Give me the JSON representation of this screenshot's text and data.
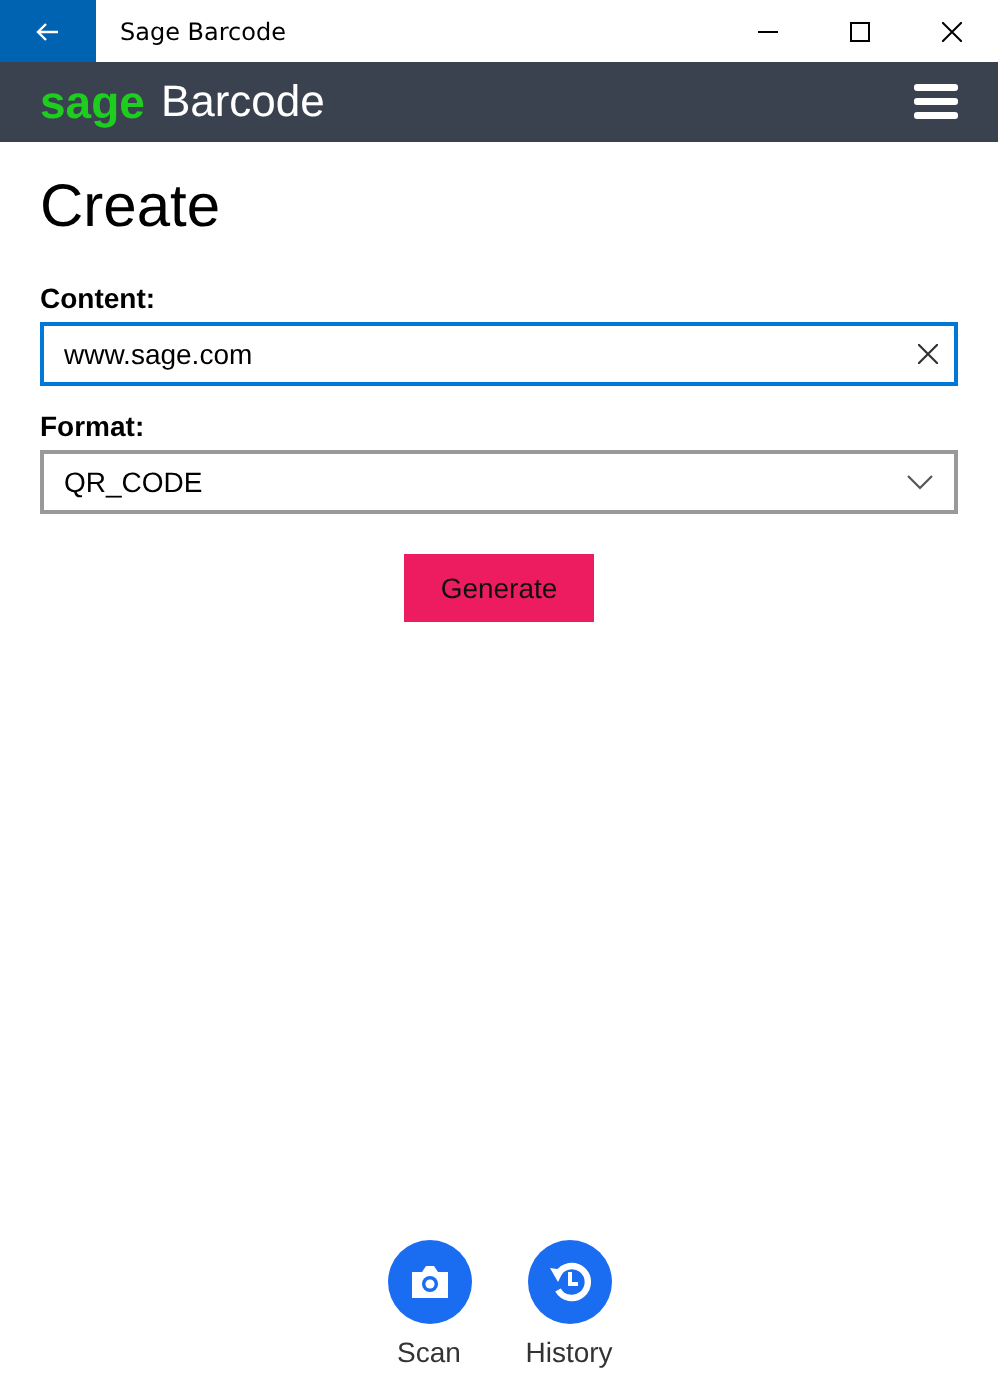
{
  "window": {
    "title": "Sage Barcode"
  },
  "header": {
    "brand": "sage",
    "title": "Barcode"
  },
  "page": {
    "heading": "Create"
  },
  "content_field": {
    "label": "Content:",
    "value": "www.sage.com",
    "focused": true
  },
  "format_field": {
    "label": "Format:",
    "value": "QR_CODE"
  },
  "generate_button": "Generate",
  "bottom_nav": [
    {
      "kind": "scan",
      "label": "Scan"
    },
    {
      "kind": "history",
      "label": "History"
    }
  ]
}
